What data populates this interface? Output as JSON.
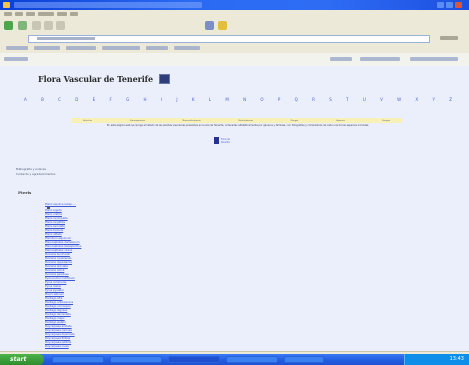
{
  "browser": {
    "menu_items": [
      "File",
      "Edit",
      "View",
      "Favorites",
      "Tools",
      "Help"
    ],
    "status_text": "",
    "taskbar": {
      "start_label": "start",
      "clock": "13:43"
    }
  },
  "page": {
    "title": "Flora Vascular de Tenerife",
    "alphabet": [
      "A",
      "B",
      "C",
      "D",
      "E",
      "F",
      "G",
      "H",
      "I",
      "J",
      "K",
      "L",
      "M",
      "N",
      "O",
      "P",
      "Q",
      "R",
      "S",
      "T",
      "U",
      "V",
      "W",
      "X",
      "Y",
      "Z"
    ],
    "categories": [
      "Helechos",
      "Gimnospermas",
      "Monocotiledóneas",
      "Dicotiledóneas",
      "Musgos",
      "Líquenes",
      "Hongos"
    ],
    "description": "En esta página web se recoge el listado de las plantas vasculares presentes en la isla de Tenerife, ordenadas alfabéticamente por géneros y familias, con fotografías y comentarios de cada una de las especies incluidas.",
    "badge_lines": [
      "Flora de",
      "Tenerife"
    ],
    "left_links": [
      "Bibliografía y enlaces",
      "Contacto y agradecimientos"
    ],
    "genus": "Pteris",
    "species": [
      "Pteris aquilina subsp. ...",
      "Pteris arguta",
      "Pteris cretica",
      "Pteris incompleta",
      "Pteris longifolia",
      "Pteris serrulata",
      "Pteris tremula",
      "Pteris vittata",
      "Pteridium aquilinum",
      "Pterocephalus dumetorum",
      "Pterocephalus lasiospermus",
      "Pterocephalus virens",
      "Pulicaria burchardii",
      "Pulicaria canariensis",
      "Pulicaria dysenterica",
      "Pulicaria laciniata",
      "Pulicaria odora",
      "Pulicaria paludosa",
      "Pycnocomon rutifolium",
      "Pyrus communis",
      "Pyrus malus",
      "Pyrus pyraster",
      "Pisum sativum",
      "Plantago afra",
      "Plantago arborescens",
      "Plantago coronopus",
      "Plantago lagopus",
      "Plantago lanceolata",
      "Plantago major",
      "Plantago webbii",
      "Polycarpaea aristata",
      "Polycarpaea carnosa",
      "Polycarpaea divaricata",
      "Polycarpaea filifolia",
      "Polycarpaea latifolia",
      "Polycarpaea nivea"
    ]
  },
  "colors": {
    "link": "#3c56d4",
    "catrow_bg": "#f7f1b7",
    "page_bg": "#ebeffb",
    "titlebar": "#2a6af2"
  }
}
